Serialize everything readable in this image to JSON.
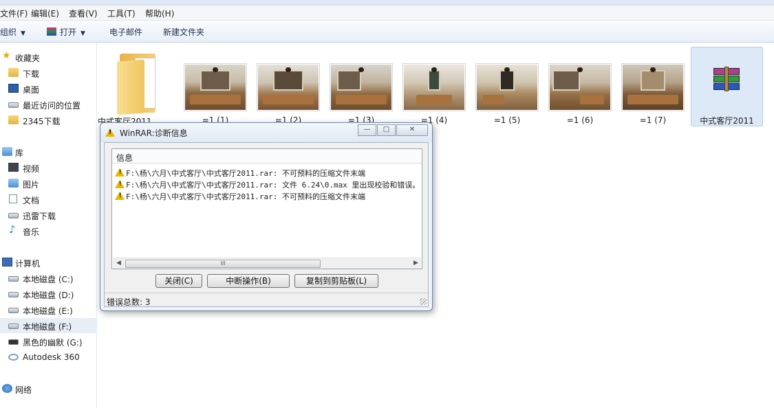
{
  "menu": [
    "文件(F)",
    "编辑(E)",
    "查看(V)",
    "工具(T)",
    "帮助(H)"
  ],
  "toolbar": {
    "organize": "组织",
    "open": "打开",
    "email": "电子邮件",
    "new_folder": "新建文件夹"
  },
  "nav": {
    "favorites": "收藏夹",
    "downloads": "下载",
    "desktop": "桌面",
    "recent": "最近访问的位置",
    "dl2345": "2345下载",
    "libraries": "库",
    "videos": "视频",
    "pictures": "图片",
    "documents": "文档",
    "xunlei": "迅雷下载",
    "music": "音乐",
    "computer": "计算机",
    "disk_c": "本地磁盘 (C:)",
    "disk_d": "本地磁盘 (D:)",
    "disk_e": "本地磁盘 (E:)",
    "disk_f": "本地磁盘 (F:)",
    "disk_g": "黑色的幽默 (G:)",
    "autodesk": "Autodesk 360",
    "network": "网络"
  },
  "files": {
    "folder": "中式客厅2011",
    "img1": "=1 (1)",
    "img2": "=1 (2)",
    "img3": "=1 (3)",
    "img4": "=1 (4)",
    "img5": "=1 (5)",
    "img6": "=1 (6)",
    "img7": "=1 (7)",
    "rar": "中式客厅2011"
  },
  "dialog": {
    "title": "WinRAR:诊断信息",
    "column_header": "信息",
    "messages": [
      "F:\\杨\\六月\\中式客厅\\中式客厅2011.rar: 不可预料的压缩文件末端",
      "F:\\杨\\六月\\中式客厅\\中式客厅2011.rar: 文件 6.24\\0.max 里出现校验和错误。",
      "F:\\杨\\六月\\中式客厅\\中式客厅2011.rar: 不可预料的压缩文件末端"
    ],
    "scroll_grip": "III",
    "close_button": "关闭(C)",
    "break_button": "中断操作(B)",
    "copy_button": "复制到剪贴板(L)",
    "error_total": "错误总数: 3"
  },
  "colors": {
    "warning": "#e9b600",
    "selection": "#dde9f7",
    "toolbar_text": "#1e3050"
  },
  "icons": {
    "favorites": "star-icon",
    "warning": "warning-icon",
    "rar": "winrar-archive-icon"
  }
}
